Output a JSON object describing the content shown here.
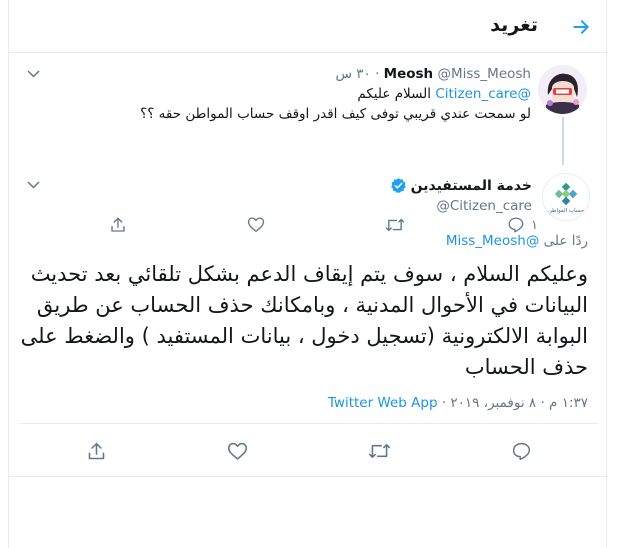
{
  "header": {
    "title": "تغريد",
    "accent": "#1da1f2"
  },
  "parent_tweet": {
    "name": "Meosh",
    "handle": "@Miss_Meosh",
    "time": "٣٠ س",
    "separator": "·",
    "reply_mention": "@Citizen_care",
    "reply_text": "السلام عليكم",
    "text": "لو سمحت عندي قريبي توفى كيف اقدر اوقف حساب المواطن حقه ؟؟",
    "reply_count": "١"
  },
  "main_tweet": {
    "name": "خدمة المستفيدين",
    "handle": "@Citizen_care",
    "replying_prefix": "ردًا على",
    "replying_to": "@Miss_Meosh",
    "text": "وعليكم السلام ، سوف يتم إيقاف الدعم بشكل تلقائي بعد تحديث البيانات في الأحوال المدنية ، وبامكانك حذف الحساب عن طريق البوابة الالكترونية (تسجيل دخول ، بيانات المستفيد ) والضغط على حذف الحساب",
    "timestamp": "١:٣٧ م · ٨ نوفمبر، ٢٠١٩ ·",
    "source": "Twitter Web App",
    "avatar_logo_text": "حساب المواطن"
  },
  "colors": {
    "link": "#1b95e0",
    "muted": "#657786",
    "verified": "#1da1f2"
  },
  "icons": [
    "back-arrow-icon",
    "chevron-down-icon",
    "reply-icon",
    "retweet-icon",
    "like-icon",
    "share-icon",
    "verified-badge-icon"
  ]
}
